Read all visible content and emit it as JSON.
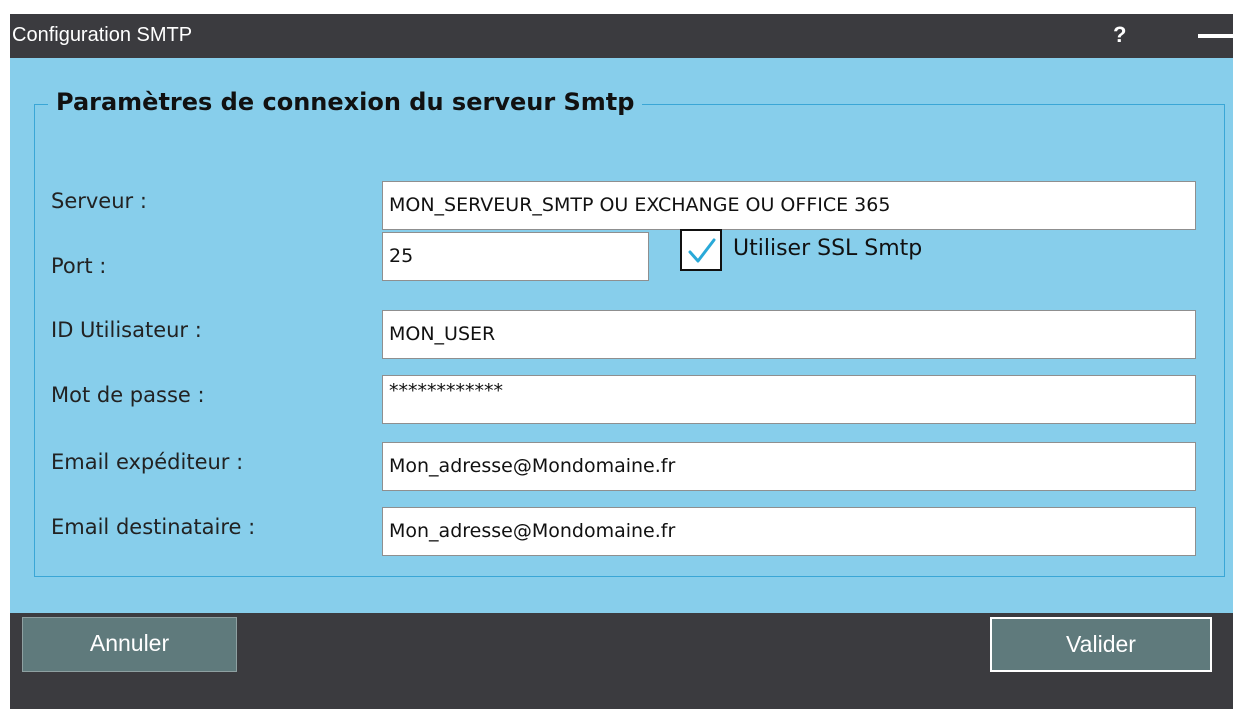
{
  "window": {
    "title": "Configuration SMTP",
    "help_label": "?",
    "colors": {
      "chrome": "#3b3b3f",
      "client": "#87ceeb",
      "button": "#5f7a7c",
      "check": "#29a9d8"
    }
  },
  "group": {
    "title": "Paramètres de connexion du serveur Smtp"
  },
  "form": {
    "server": {
      "label": "Serveur :",
      "value": "MON_SERVEUR_SMTP OU EXCHANGE OU OFFICE 365"
    },
    "port": {
      "label": "Port :",
      "value": "25"
    },
    "ssl": {
      "label": "Utiliser SSL Smtp",
      "checked": true
    },
    "user": {
      "label": "ID Utilisateur :",
      "value": "MON_USER"
    },
    "password": {
      "label": "Mot de passe :",
      "value": "************"
    },
    "sender": {
      "label": "Email expéditeur :",
      "value": "Mon_adresse@Mondomaine.fr"
    },
    "recipient": {
      "label": "Email destinataire :",
      "value": "Mon_adresse@Mondomaine.fr"
    }
  },
  "buttons": {
    "cancel_label": "Annuler",
    "ok_label": "Valider"
  }
}
